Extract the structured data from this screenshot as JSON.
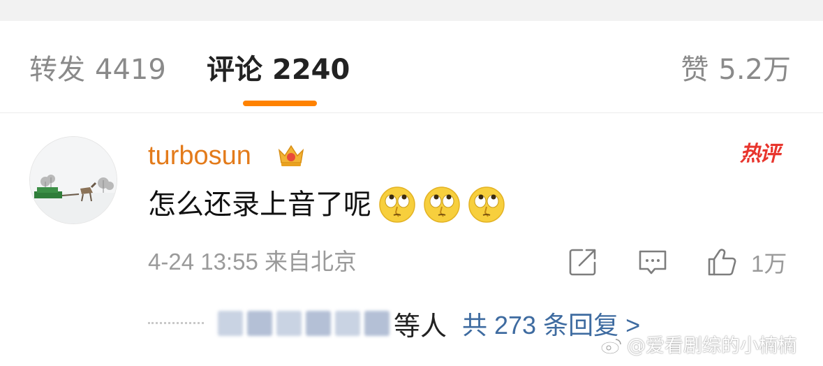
{
  "tabs": {
    "repost": {
      "label": "转发",
      "count": "4419"
    },
    "comment": {
      "label": "评论",
      "count": "2240"
    },
    "like": {
      "label": "赞",
      "count": "5.2万"
    }
  },
  "colors": {
    "accent": "#ff8200",
    "username": "#e37b1b",
    "hot": "#e8352d",
    "link": "#3e6ba0",
    "meta": "#9a9a9a"
  },
  "comment": {
    "username": "turbosun",
    "badge_icon": "crown-icon",
    "hot_label": "热评",
    "text": "怎么还录上音了呢",
    "emojis": [
      "rolling-eyes-emoji",
      "rolling-eyes-emoji",
      "rolling-eyes-emoji"
    ],
    "meta": "4-24 13:55 来自北京",
    "actions": {
      "share_icon": "share-icon",
      "reply_icon": "comment-icon",
      "like_icon": "thumbs-up-icon",
      "like_count": "1万"
    },
    "replies": {
      "suffix": "等人",
      "link": "共 273 条回复 >"
    }
  },
  "watermark": "@爱看剧综的小楠楠"
}
